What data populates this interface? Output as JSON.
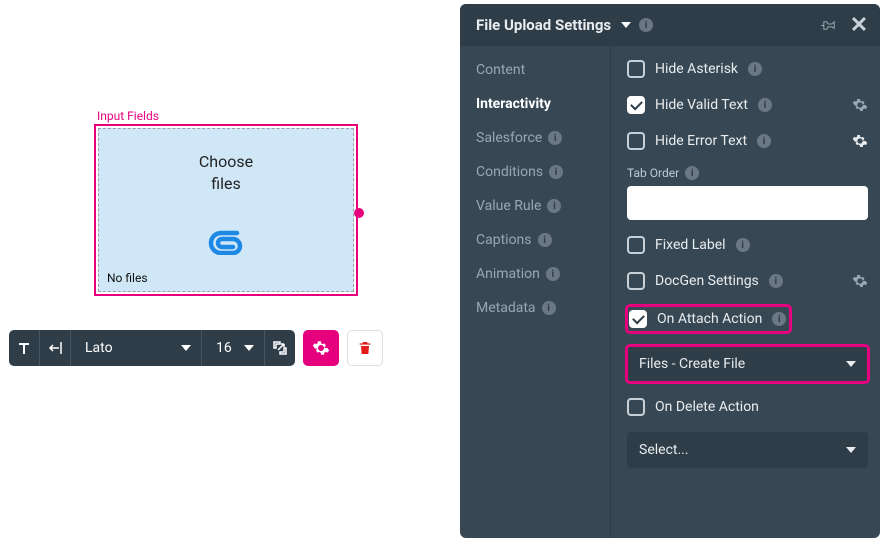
{
  "canvas": {
    "component_label": "Input Fields",
    "choose_line1": "Choose",
    "choose_line2": "files",
    "no_files": "No files"
  },
  "toolbar": {
    "font": "Lato",
    "size": "16"
  },
  "panel": {
    "title": "File Upload Settings",
    "tabs": [
      {
        "label": "Content",
        "badge": false
      },
      {
        "label": "Interactivity",
        "badge": false
      },
      {
        "label": "Salesforce",
        "badge": true
      },
      {
        "label": "Conditions",
        "badge": true
      },
      {
        "label": "Value Rule",
        "badge": true
      },
      {
        "label": "Captions",
        "badge": true
      },
      {
        "label": "Animation",
        "badge": true
      },
      {
        "label": "Metadata",
        "badge": true
      }
    ],
    "active_tab": "Interactivity",
    "settings": {
      "hide_asterisk": {
        "label": "Hide Asterisk",
        "checked": false
      },
      "hide_valid": {
        "label": "Hide Valid Text",
        "checked": true
      },
      "hide_error": {
        "label": "Hide Error Text",
        "checked": false
      },
      "tab_order_label": "Tab Order",
      "tab_order_value": "",
      "fixed_label": {
        "label": "Fixed Label",
        "checked": false
      },
      "docgen": {
        "label": "DocGen Settings",
        "checked": false
      },
      "on_attach": {
        "label": "On Attach Action",
        "checked": true
      },
      "attach_select": "Files - Create File",
      "on_delete": {
        "label": "On Delete Action",
        "checked": false
      },
      "delete_select": "Select..."
    }
  }
}
